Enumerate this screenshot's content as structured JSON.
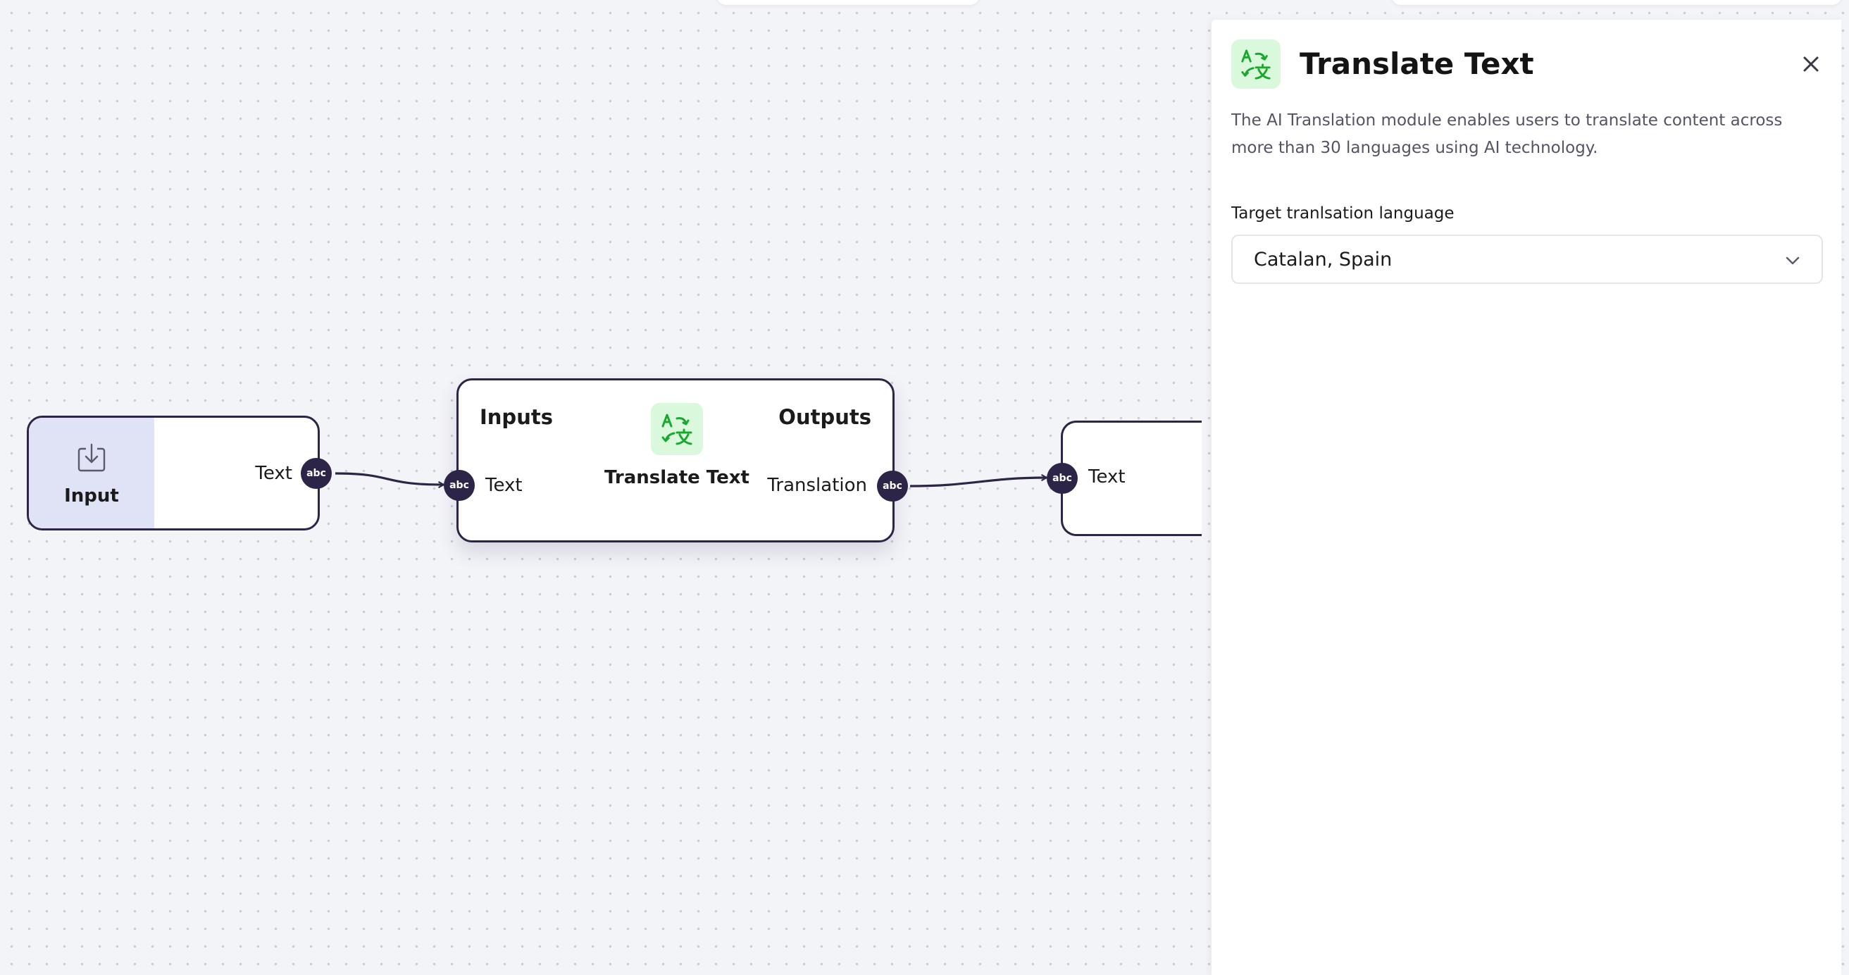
{
  "canvas": {
    "input_node": {
      "label": "Input",
      "output_port_label": "Text",
      "port_type": "abc"
    },
    "translate_node": {
      "inputs_header": "Inputs",
      "outputs_header": "Outputs",
      "title": "Translate Text",
      "input_port_label": "Text",
      "output_port_label": "Translation",
      "port_type": "abc",
      "icon": "translate-icon"
    },
    "output_node": {
      "input_port_label": "Text",
      "port_type": "abc"
    }
  },
  "panel": {
    "title": "Translate Text",
    "icon": "translate-icon",
    "description": "The AI Translation module enables users to translate content across more than 30 languages using AI technology.",
    "field_label": "Target tranlsation language",
    "selected_language": "Catalan, Spain"
  },
  "colors": {
    "node_border": "#2d2547",
    "accent_green": "#1aa82e",
    "tile_green_bg": "#d9f8dc",
    "input_tile_bg": "#dfe3f5"
  }
}
